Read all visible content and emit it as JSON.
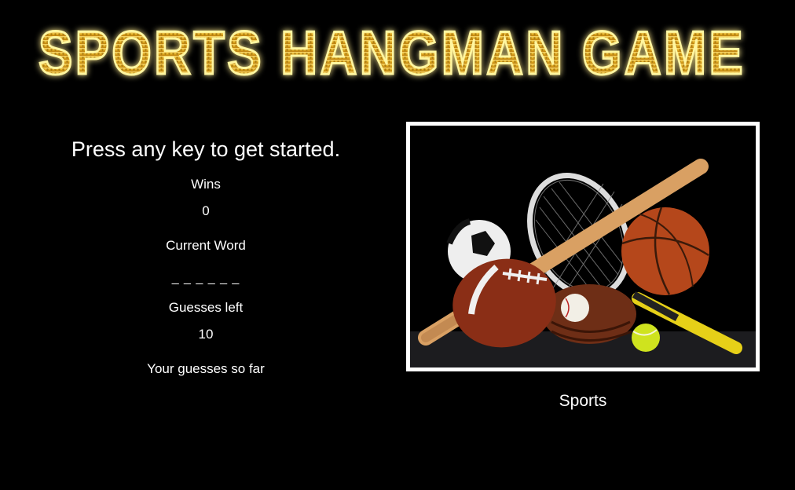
{
  "game": {
    "title": "SPORTS HANGMAN GAME",
    "start_prompt": "Press any key to get started.",
    "wins_label": "Wins",
    "wins_value": "0",
    "current_word_label": "Current Word",
    "current_word_display": "_ _ _ _ _ _",
    "guesses_left_label": "Guesses left",
    "guesses_left_value": "10",
    "guessed_letters_label": "Your guesses so far",
    "guessed_letters": ""
  },
  "image": {
    "caption": "Sports",
    "subject": "sports-equipment-photo"
  },
  "colors": {
    "background": "#000000",
    "title_gold_light": "#f5d060",
    "title_gold_dark": "#c88a10",
    "title_glow": "#fff6a0",
    "text": "#ffffff"
  }
}
